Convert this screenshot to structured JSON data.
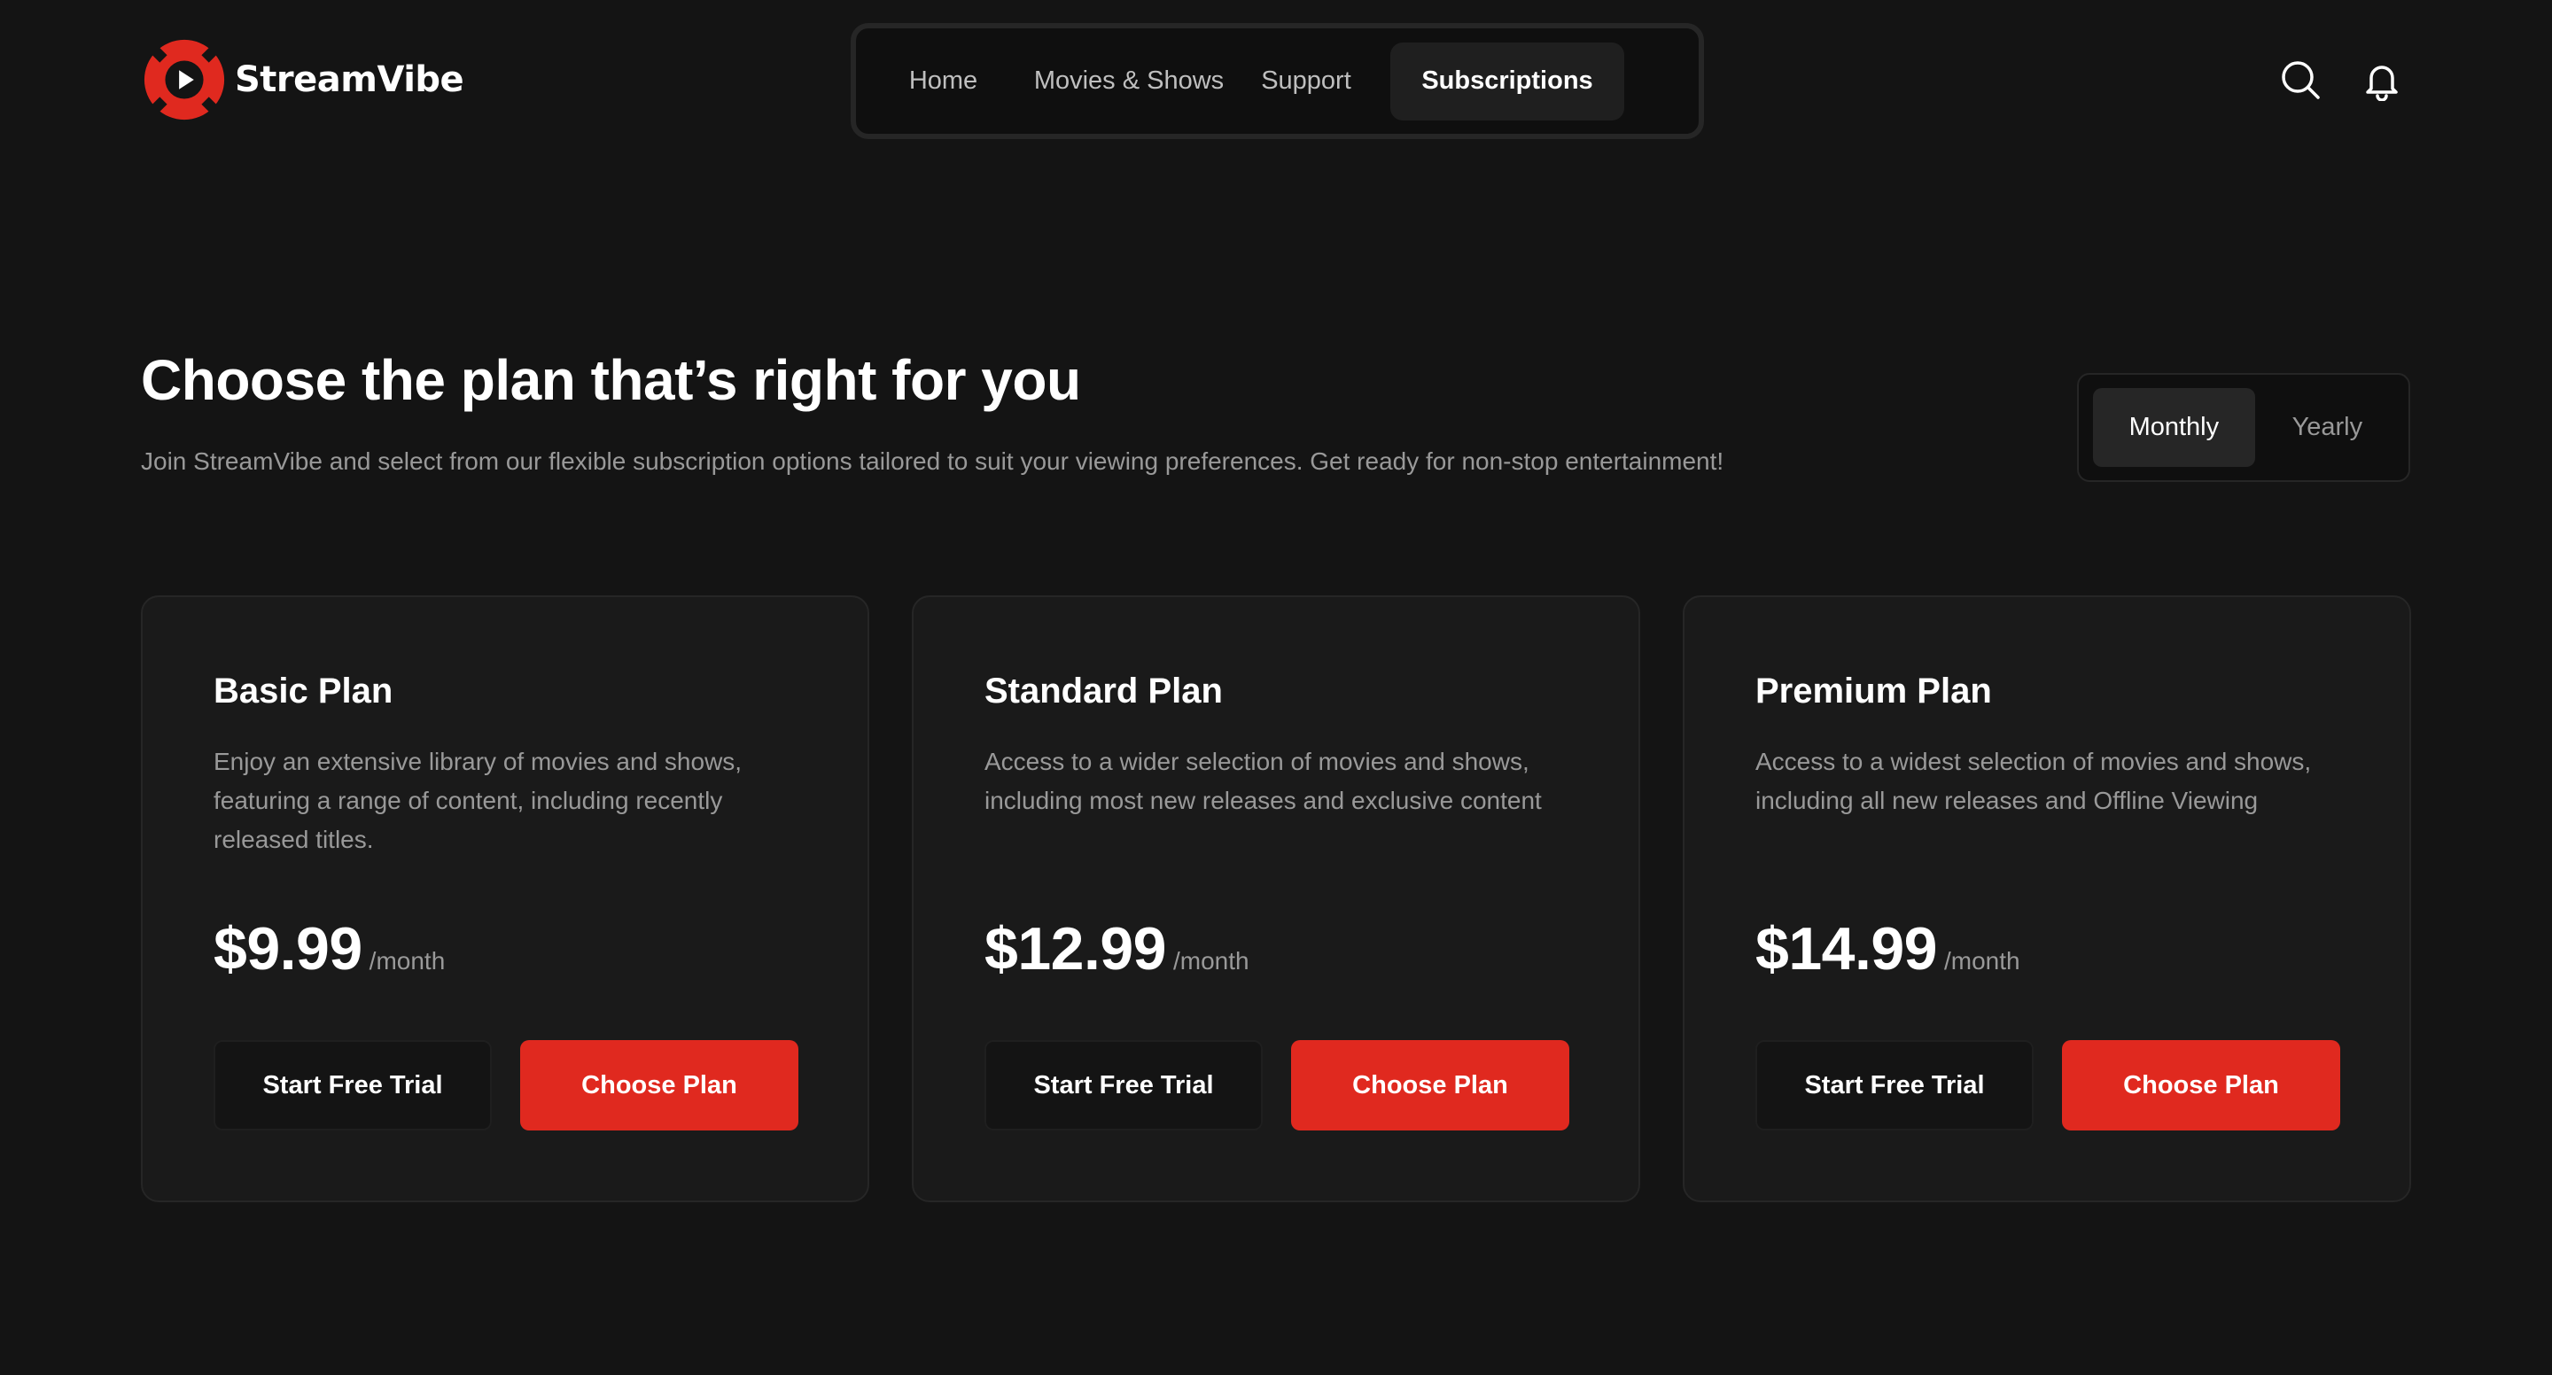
{
  "brand": {
    "name": "StreamVibe",
    "logo_icon": "streamvibe-logo-icon",
    "accent_color": "#e0291f"
  },
  "nav": {
    "items": [
      {
        "label": "Home",
        "active": false
      },
      {
        "label": "Movies & Shows",
        "active": false
      },
      {
        "label": "Support",
        "active": false
      },
      {
        "label": "Subscriptions",
        "active": true
      }
    ]
  },
  "header_icons": [
    "search-icon",
    "bell-icon"
  ],
  "hero": {
    "title": "Choose the plan that’s right for you",
    "description": "Join StreamVibe and select from our flexible subscription options tailored to suit your viewing preferences. Get ready for non-stop entertainment!"
  },
  "billing_toggle": {
    "options": [
      "Monthly",
      "Yearly"
    ],
    "selected": "Monthly"
  },
  "plans": [
    {
      "title": "Basic Plan",
      "description": "Enjoy an extensive library of movies and shows, featuring a range of content, including recently released titles.",
      "price": "$9.99",
      "period": "/month",
      "trial_label": "Start Free Trial",
      "choose_label": "Choose Plan"
    },
    {
      "title": "Standard Plan",
      "description": "Access to a wider selection of movies and shows, including most new releases and exclusive content",
      "price": "$12.99",
      "period": "/month",
      "trial_label": "Start Free Trial",
      "choose_label": "Choose Plan"
    },
    {
      "title": "Premium Plan",
      "description": "Access to a widest selection of movies and shows, including all new releases and Offline Viewing",
      "price": "$14.99",
      "period": "/month",
      "trial_label": "Start Free Trial",
      "choose_label": "Choose Plan"
    }
  ]
}
